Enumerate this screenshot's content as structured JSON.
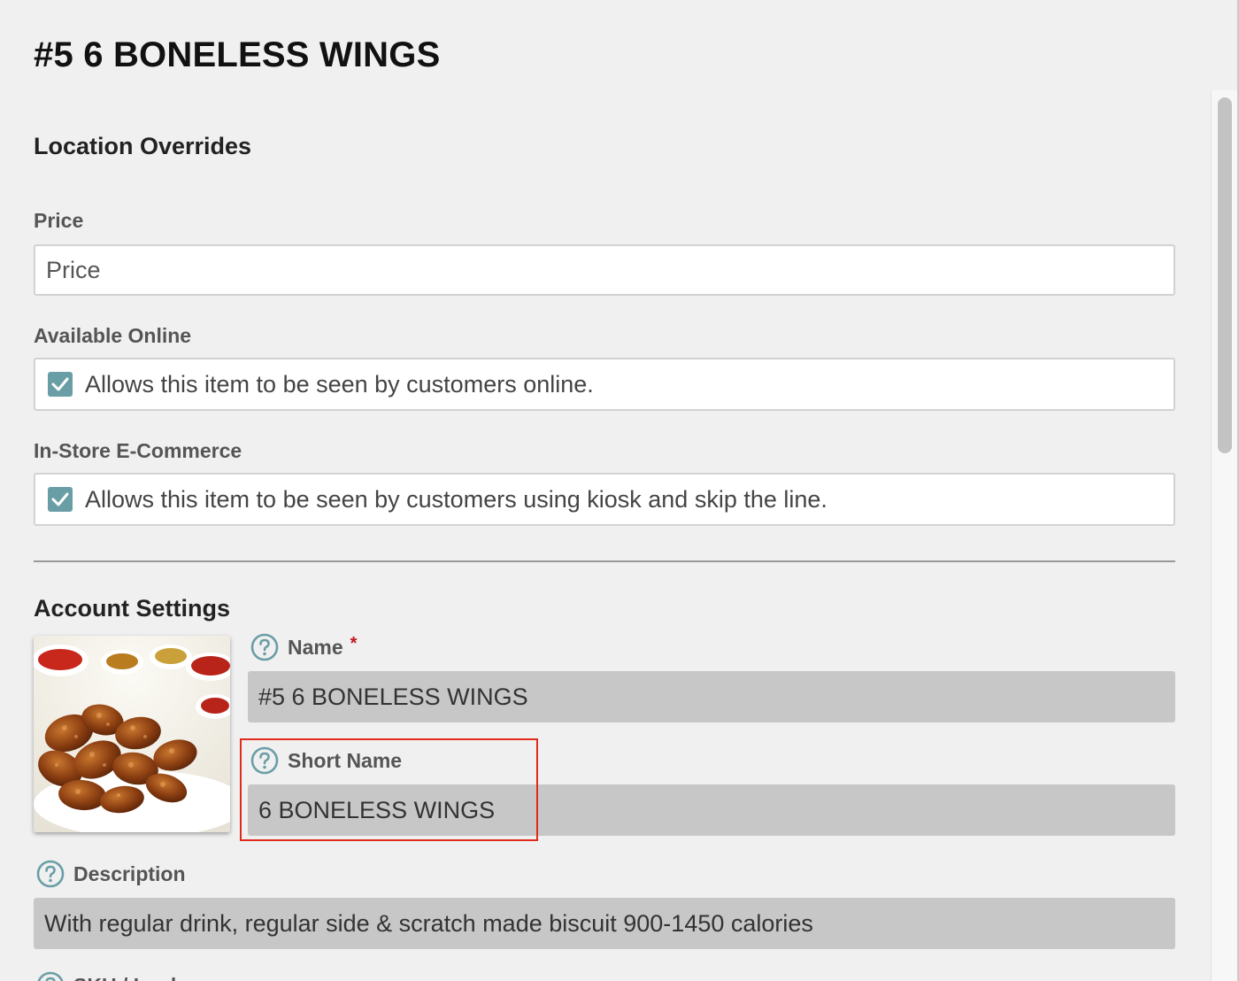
{
  "page": {
    "title": "#5 6 BONELESS WINGS"
  },
  "location_overrides": {
    "heading": "Location Overrides",
    "price": {
      "label": "Price",
      "placeholder": "Price",
      "value": ""
    },
    "available_online": {
      "label": "Available Online",
      "checked": true,
      "text": "Allows this item to be seen by customers online."
    },
    "in_store_ecommerce": {
      "label": "In-Store E-Commerce",
      "checked": true,
      "text": "Allows this item to be seen by customers using kiosk and skip the line."
    }
  },
  "account_settings": {
    "heading": "Account Settings",
    "name": {
      "label": "Name",
      "required_mark": "*",
      "value": "#5 6 BONELESS WINGS"
    },
    "short_name": {
      "label": "Short Name",
      "value": "6 BONELESS WINGS"
    },
    "description": {
      "label": "Description",
      "value": "With regular drink, regular side & scratch made biscuit 900-1450 calories"
    },
    "next_field": {
      "label": "SKU / Lookup"
    }
  },
  "colors": {
    "checkbox": "#6a9ea6",
    "help_icon": "#6a9ea6",
    "required": "#c0161b",
    "highlight": "#e02b1c",
    "readonly_field": "#c7c7c7"
  },
  "icons": {
    "help": "question-circle-icon",
    "check": "checkmark-icon"
  }
}
